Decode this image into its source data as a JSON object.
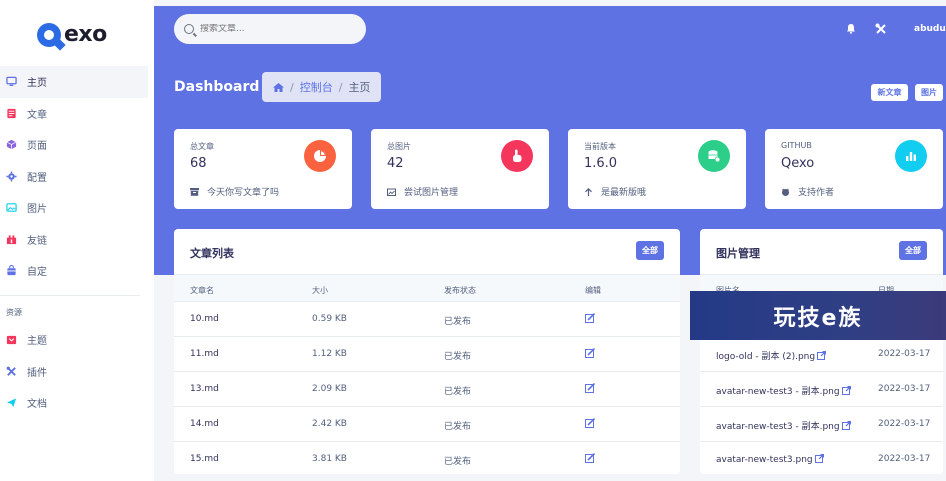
{
  "brand": {
    "logo_text": "exo"
  },
  "sidebar": {
    "items": [
      {
        "label": "主页",
        "icon": "monitor-icon",
        "color": "#5e72e4",
        "active": true
      },
      {
        "label": "文章",
        "icon": "article-icon",
        "color": "#f5365c"
      },
      {
        "label": "页面",
        "icon": "cube-icon",
        "color": "#8965e0"
      },
      {
        "label": "配置",
        "icon": "gear-icon",
        "color": "#5e72e4"
      },
      {
        "label": "图片",
        "icon": "image-icon",
        "color": "#11cdef"
      },
      {
        "label": "友链",
        "icon": "link-icon",
        "color": "#f5365c"
      },
      {
        "label": "自定",
        "icon": "bag-icon",
        "color": "#5e72e4"
      }
    ],
    "section_label": "资源",
    "resources": [
      {
        "label": "主题",
        "icon": "theme-icon",
        "color": "#f5365c"
      },
      {
        "label": "插件",
        "icon": "tools-icon",
        "color": "#5e72e4"
      },
      {
        "label": "文档",
        "icon": "send-icon",
        "color": "#11cdef"
      }
    ]
  },
  "header": {
    "search_placeholder": "搜索文章...",
    "username": "abudu",
    "title": "Dashboard",
    "breadcrumb": [
      "控制台",
      "主页"
    ],
    "new_article_label": "新文章",
    "images_label": "图片"
  },
  "stats": [
    {
      "label": "总文章",
      "value": "68",
      "foot": "今天你写文章了吗",
      "icon": "pie-icon",
      "color": "#fb6340"
    },
    {
      "label": "总图片",
      "value": "42",
      "foot": "尝试图片管理",
      "icon": "pointer-icon",
      "color": "#f5365c"
    },
    {
      "label": "当前版本",
      "value": "1.6.0",
      "foot": "是最新版哦",
      "icon": "database-icon",
      "color": "#2dce89"
    },
    {
      "label": "GITHUB",
      "value": "Qexo",
      "foot": "支持作者",
      "icon": "chart-icon",
      "color": "#11cdef"
    }
  ],
  "articles": {
    "title": "文章列表",
    "all_label": "全部",
    "headers": [
      "文章名",
      "大小",
      "发布状态",
      "编辑"
    ],
    "rows": [
      {
        "name": "10.md",
        "size": "0.59 KB",
        "status": "已发布"
      },
      {
        "name": "11.md",
        "size": "1.12 KB",
        "status": "已发布"
      },
      {
        "name": "13.md",
        "size": "2.09 KB",
        "status": "已发布"
      },
      {
        "name": "14.md",
        "size": "2.42 KB",
        "status": "已发布"
      },
      {
        "name": "15.md",
        "size": "3.81 KB",
        "status": "已发布"
      }
    ]
  },
  "images": {
    "title": "图片管理",
    "all_label": "全部",
    "headers": [
      "图片名",
      "日期"
    ],
    "rows": [
      {
        "name": "logo-old - 副本 (2).png",
        "date": "2022-03-17"
      },
      {
        "name": "avatar-new-test3 - 副本.png",
        "date": "2022-03-17"
      },
      {
        "name": "avatar-new-test3 - 副本.png",
        "date": "2022-03-17"
      },
      {
        "name": "avatar-new-test3.png",
        "date": "2022-03-17"
      }
    ]
  },
  "watermark": "玩技e族"
}
